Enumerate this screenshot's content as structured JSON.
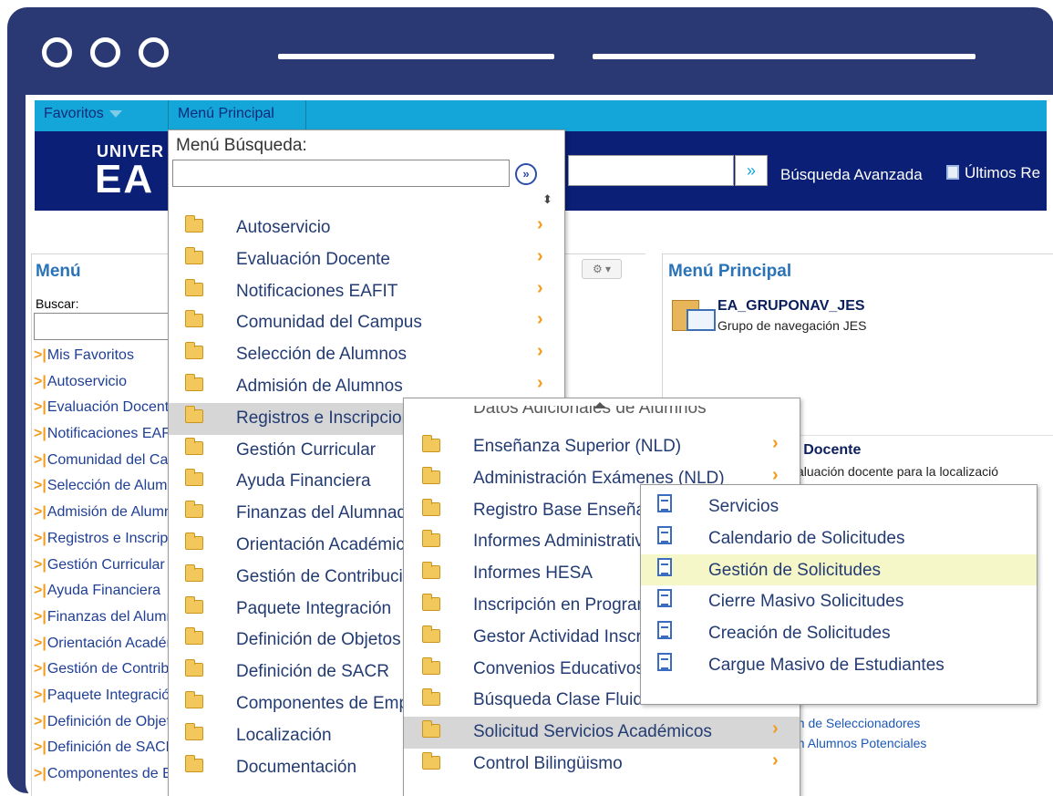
{
  "nav": {
    "favorites": "Favoritos",
    "main_menu": "Menú Principal"
  },
  "banner": {
    "logo_top": "UNIVER",
    "logo_bottom": "EA",
    "advanced_search": "Búsqueda Avanzada",
    "recent": "Últimos Re",
    "go_glyph": "»"
  },
  "left_panel": {
    "title": "Menú",
    "search_label": "Buscar:",
    "items": [
      "Mis Favoritos",
      "Autoservicio",
      "Evaluación Docente",
      "Notificaciones EAFIT",
      "Comunidad del Campus",
      "Selección de Alumnos",
      "Admisión de Alumnos",
      "Registros e Inscripciones",
      "Gestión Curricular",
      "Ayuda Financiera",
      "Finanzas del Alumnado",
      "Orientación Académica",
      "Gestión de Contribuciones",
      "Paquete Integración",
      "Definición de Objetos",
      "Definición de SACR",
      "Componentes de Empresa"
    ]
  },
  "right_panel": {
    "title": "Menú Principal",
    "folder_name": "EA_GRUPONAV_JES",
    "folder_desc": "Grupo de navegación JES",
    "section2_title": "n Docente",
    "section2_desc": "valuación docente para la localizació",
    "link_cut": "...",
    "link1": "ón de Seleccionadores",
    "link2": "ón Alumnos Potenciales"
  },
  "menu1": {
    "search_label": "Menú Búsqueda:",
    "search_value": "",
    "go_glyph": "»",
    "sort_glyph": "⬍",
    "items": [
      {
        "label": "Autoservicio",
        "chevron": true
      },
      {
        "label": "Evaluación Docente",
        "chevron": true
      },
      {
        "label": "Notificaciones EAFIT",
        "chevron": true
      },
      {
        "label": "Comunidad del Campus",
        "chevron": true
      },
      {
        "label": "Selección de Alumnos",
        "chevron": true
      },
      {
        "label": "Admisión de Alumnos",
        "chevron": true
      },
      {
        "label": "Registros e Inscripciones",
        "chevron": false,
        "active": true
      },
      {
        "label": "Gestión Curricular",
        "chevron": false
      },
      {
        "label": "Ayuda Financiera",
        "chevron": false
      },
      {
        "label": "Finanzas del Alumnado",
        "chevron": false
      },
      {
        "label": "Orientación Académica",
        "chevron": false
      },
      {
        "label": "Gestión de Contribuciones",
        "chevron": false
      },
      {
        "label": "Paquete Integración",
        "chevron": false
      },
      {
        "label": "Definición de Objetos",
        "chevron": false
      },
      {
        "label": "Definición de SACR",
        "chevron": false
      },
      {
        "label": "Componentes de Empresa",
        "chevron": false
      },
      {
        "label": "Localización",
        "chevron": false
      },
      {
        "label": "Documentación",
        "chevron": false
      }
    ]
  },
  "menu2": {
    "cut_item": "Datos Adicionales de Alumnos",
    "items": [
      {
        "label": "Enseñanza Superior (NLD)",
        "chevron": true
      },
      {
        "label": "Administración Exámenes (NLD)",
        "chevron": true
      },
      {
        "label": "Registro Base Enseñanza",
        "chevron": false
      },
      {
        "label": "Informes Administrativos",
        "chevron": false
      },
      {
        "label": "Informes HESA",
        "chevron": false
      },
      {
        "label": "Inscripción en Programa",
        "chevron": false
      },
      {
        "label": "Gestor Actividad Inscripción",
        "chevron": false
      },
      {
        "label": "Convenios Educativos",
        "chevron": false
      },
      {
        "label": "Búsqueda Clase Fluida",
        "chevron": false
      },
      {
        "label": "Solicitud Servicios Académicos",
        "chevron": true,
        "active": true
      },
      {
        "label": "Control Bilingüismo",
        "chevron": true
      }
    ]
  },
  "menu3": {
    "items": [
      {
        "label": "Servicios"
      },
      {
        "label": "Calendario de Solicitudes"
      },
      {
        "label": "Gestión de Solicitudes",
        "hover": true
      },
      {
        "label": "Cierre Masivo Solicitudes"
      },
      {
        "label": "Creación de Solicitudes"
      },
      {
        "label": "Cargue Masivo de Estudiantes"
      }
    ]
  },
  "chevron_glyph": "›",
  "colors": {
    "frame": "#2a3874",
    "nav_strip": "#15a6d9",
    "banner": "#0a1f75",
    "menu_text": "#233b73",
    "chevron": "#f39b1c",
    "hover": "#f5f7c9",
    "active": "#d6d6d6"
  }
}
